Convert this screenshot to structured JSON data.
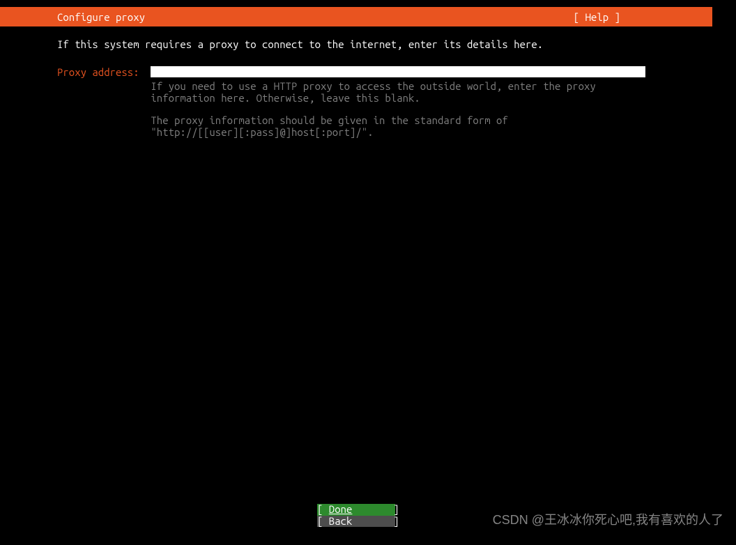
{
  "header": {
    "title": "Configure proxy",
    "help": "[ Help ]"
  },
  "instruction": "If this system requires a proxy to connect to the internet, enter its details here.",
  "field": {
    "label": "Proxy address:  ",
    "value": ""
  },
  "help_line1": "If you need to use a HTTP proxy to access the outside world, enter the proxy",
  "help_line2": "information here. Otherwise, leave this blank.",
  "help_line3": "The proxy information should be given in the standard form of",
  "help_line4": "\"http://[[user][:pass]@]host[:port]/\".",
  "buttons": {
    "done": "Done",
    "back": "Back"
  },
  "watermark": "CSDN @王冰冰你死心吧,我有喜欢的人了"
}
